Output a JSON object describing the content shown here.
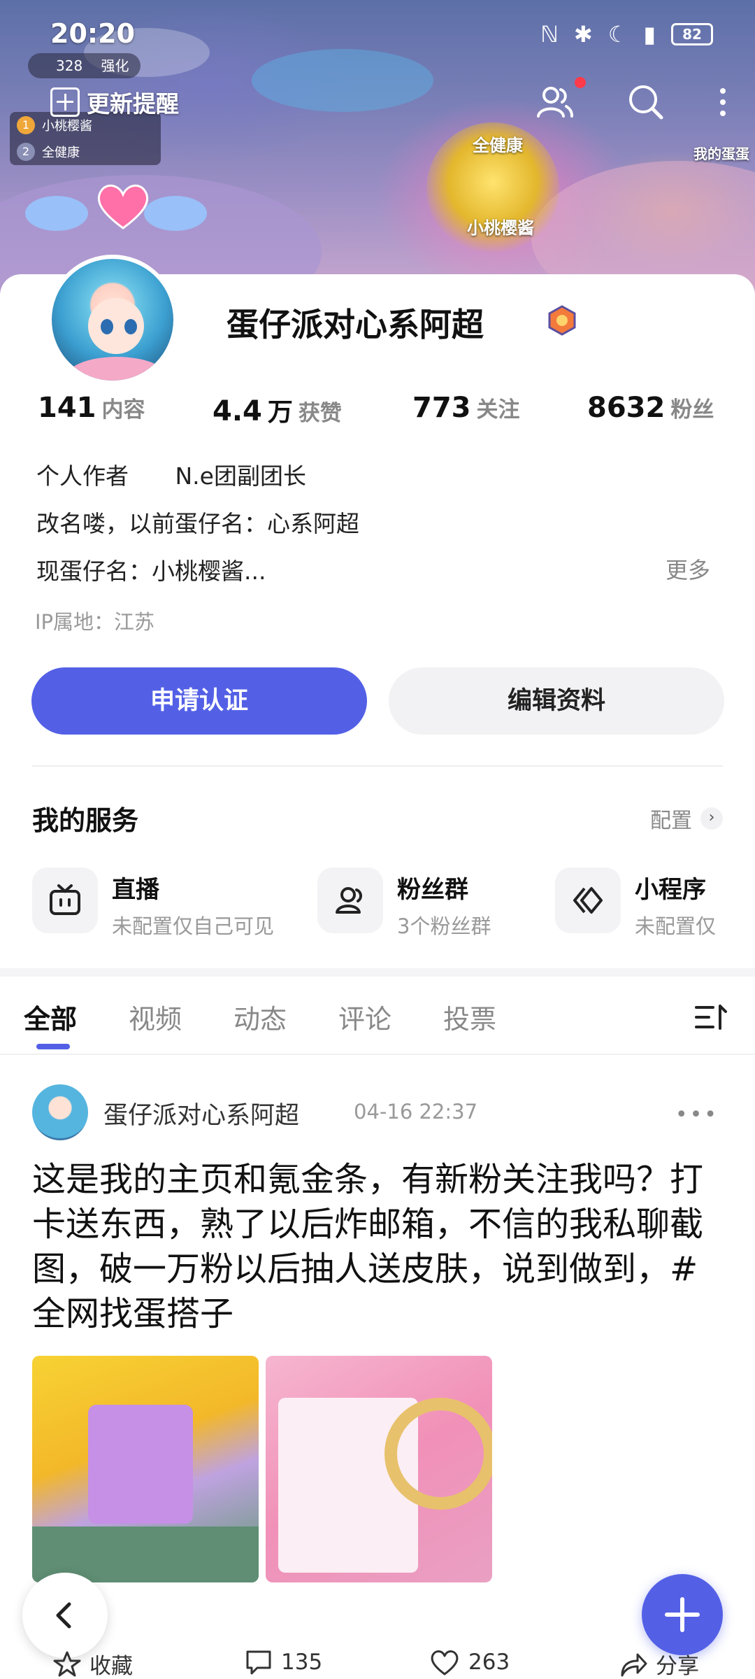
{
  "status_bar": {
    "time": "20:20",
    "battery": "82"
  },
  "hud": {
    "coins": "328",
    "strengthen": "强化",
    "players": [
      {
        "rank": "1",
        "name": "小桃樱酱"
      },
      {
        "rank": "2",
        "name": "全健康"
      }
    ],
    "tag_main": "全健康",
    "tag_sub": "小桃樱酱",
    "tag_side": "我的蛋蛋"
  },
  "header": {
    "update_label": "更新提醒"
  },
  "profile": {
    "name": "蛋仔派对心系阿超",
    "stats": [
      {
        "num": "141",
        "unit": "",
        "label": "内容"
      },
      {
        "num": "4.4",
        "unit": "万",
        "label": "获赞"
      },
      {
        "num": "773",
        "unit": "",
        "label": "关注"
      },
      {
        "num": "8632",
        "unit": "",
        "label": "粉丝"
      }
    ],
    "bio_line1_a": "个人作者",
    "bio_line1_b": "N.e团副团长",
    "bio_line2": "改名喽，以前蛋仔名：心系阿超",
    "bio_line3": "现蛋仔名：小桃樱酱...",
    "more": "更多",
    "ip": "IP属地：江苏",
    "btn_verify": "申请认证",
    "btn_edit": "编辑资料"
  },
  "services": {
    "title": "我的服务",
    "config": "配置",
    "items": [
      {
        "name": "直播",
        "sub": "未配置仅自己可见",
        "icon": "tv-icon"
      },
      {
        "name": "粉丝群",
        "sub": "3个粉丝群",
        "icon": "group-icon"
      },
      {
        "name": "小程序",
        "sub": "未配置仅",
        "icon": "mini-program-icon"
      }
    ]
  },
  "tabs": [
    "全部",
    "视频",
    "动态",
    "评论",
    "投票"
  ],
  "post": {
    "author": "蛋仔派对心系阿超",
    "time": "04-16 22:37",
    "text": "这是我的主页和氪金条，有新粉关注我吗？打卡送东西，熟了以后炸邮箱，不信的我私聊截图，破一万粉以后抽人送皮肤，说到做到，#全网找蛋搭子"
  },
  "actions": {
    "favorite": "收藏",
    "comments": "135",
    "likes": "263",
    "share": "分享"
  },
  "colors": {
    "accent": "#5360e6",
    "secondary_btn": "#f2f2f4",
    "muted_text": "#888888"
  }
}
